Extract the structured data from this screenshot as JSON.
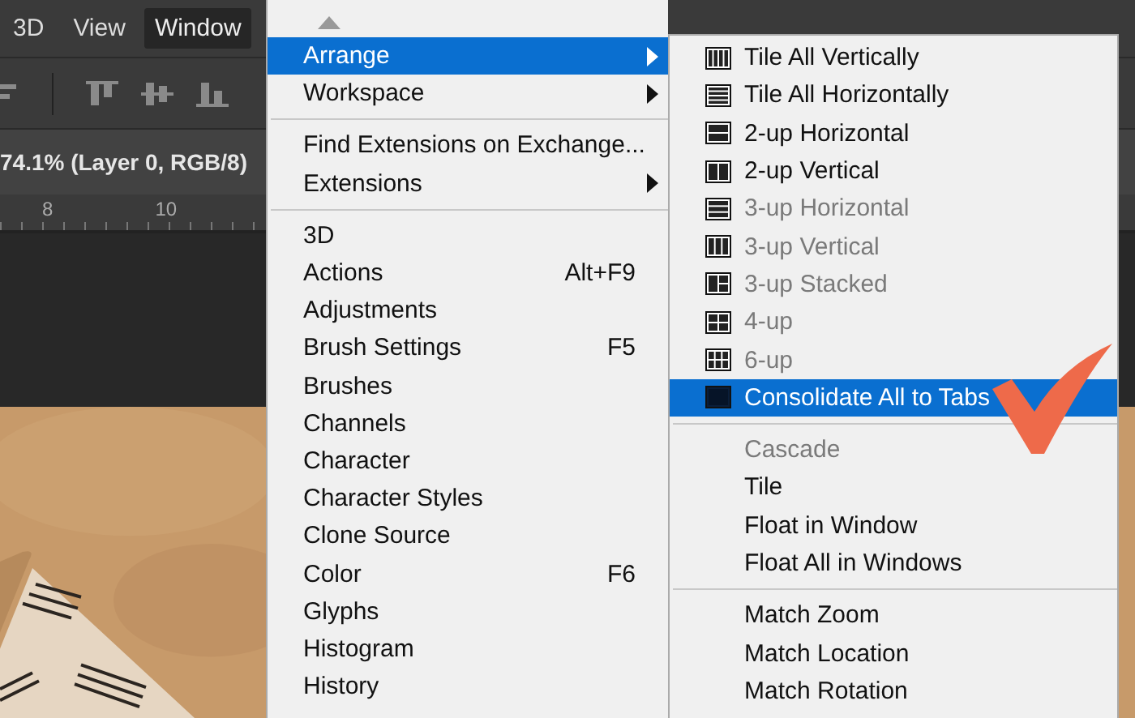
{
  "menu_bar": [
    {
      "label": "3D",
      "selected": false
    },
    {
      "label": "View",
      "selected": false
    },
    {
      "label": "Window",
      "selected": true
    }
  ],
  "document_tab": {
    "title": "74.1% (Layer 0, RGB/8)"
  },
  "ruler": {
    "labels": [
      "8",
      "10"
    ]
  },
  "window_menu": {
    "items": [
      {
        "kind": "item",
        "label": "Arrange",
        "submenu": true,
        "selected": true
      },
      {
        "kind": "item",
        "label": "Workspace",
        "submenu": true,
        "selected": false
      },
      {
        "kind": "separator"
      },
      {
        "kind": "item",
        "label": "Find Extensions on Exchange...",
        "submenu": false,
        "selected": false
      },
      {
        "kind": "item",
        "label": "Extensions",
        "submenu": true,
        "selected": false
      },
      {
        "kind": "separator"
      },
      {
        "kind": "item",
        "label": "3D",
        "submenu": false,
        "selected": false
      },
      {
        "kind": "item",
        "label": "Actions",
        "shortcut": "Alt+F9",
        "submenu": false,
        "selected": false
      },
      {
        "kind": "item",
        "label": "Adjustments",
        "submenu": false,
        "selected": false
      },
      {
        "kind": "item",
        "label": "Brush Settings",
        "shortcut": "F5",
        "submenu": false,
        "selected": false
      },
      {
        "kind": "item",
        "label": "Brushes",
        "submenu": false,
        "selected": false
      },
      {
        "kind": "item",
        "label": "Channels",
        "submenu": false,
        "selected": false
      },
      {
        "kind": "item",
        "label": "Character",
        "submenu": false,
        "selected": false
      },
      {
        "kind": "item",
        "label": "Character Styles",
        "submenu": false,
        "selected": false
      },
      {
        "kind": "item",
        "label": "Clone Source",
        "submenu": false,
        "selected": false
      },
      {
        "kind": "item",
        "label": "Color",
        "shortcut": "F6",
        "submenu": false,
        "selected": false
      },
      {
        "kind": "item",
        "label": "Glyphs",
        "submenu": false,
        "selected": false
      },
      {
        "kind": "item",
        "label": "Histogram",
        "submenu": false,
        "selected": false
      },
      {
        "kind": "item",
        "label": "History",
        "submenu": false,
        "selected": false
      }
    ]
  },
  "arrange_submenu": {
    "items": [
      {
        "kind": "cols4",
        "label": "Tile All Vertically",
        "disabled": false,
        "selected": false
      },
      {
        "kind": "rows4",
        "label": "Tile All Horizontally",
        "disabled": false,
        "selected": false
      },
      {
        "kind": "rows2",
        "label": "2-up Horizontal",
        "disabled": false,
        "selected": false
      },
      {
        "kind": "cols2",
        "label": "2-up Vertical",
        "disabled": false,
        "selected": false
      },
      {
        "kind": "rows3",
        "label": "3-up Horizontal",
        "disabled": true,
        "selected": false
      },
      {
        "kind": "cols3",
        "label": "3-up Vertical",
        "disabled": true,
        "selected": false
      },
      {
        "kind": "stacked",
        "label": "3-up Stacked",
        "disabled": true,
        "selected": false
      },
      {
        "kind": "grid4",
        "label": "4-up",
        "disabled": true,
        "selected": false
      },
      {
        "kind": "grid6",
        "label": "6-up",
        "disabled": true,
        "selected": false
      },
      {
        "kind": "single",
        "label": "Consolidate All to Tabs",
        "disabled": false,
        "selected": true
      },
      {
        "kind": "separator"
      },
      {
        "kind": "text",
        "label": "Cascade",
        "disabled": true,
        "selected": false
      },
      {
        "kind": "text",
        "label": "Tile",
        "disabled": false,
        "selected": false
      },
      {
        "kind": "text",
        "label": "Float in Window",
        "disabled": false,
        "selected": false
      },
      {
        "kind": "text",
        "label": "Float All in Windows",
        "disabled": false,
        "selected": false
      },
      {
        "kind": "separator"
      },
      {
        "kind": "text",
        "label": "Match Zoom",
        "disabled": false,
        "selected": false
      },
      {
        "kind": "text",
        "label": "Match Location",
        "disabled": false,
        "selected": false
      },
      {
        "kind": "text",
        "label": "Match Rotation",
        "disabled": false,
        "selected": false
      }
    ]
  }
}
